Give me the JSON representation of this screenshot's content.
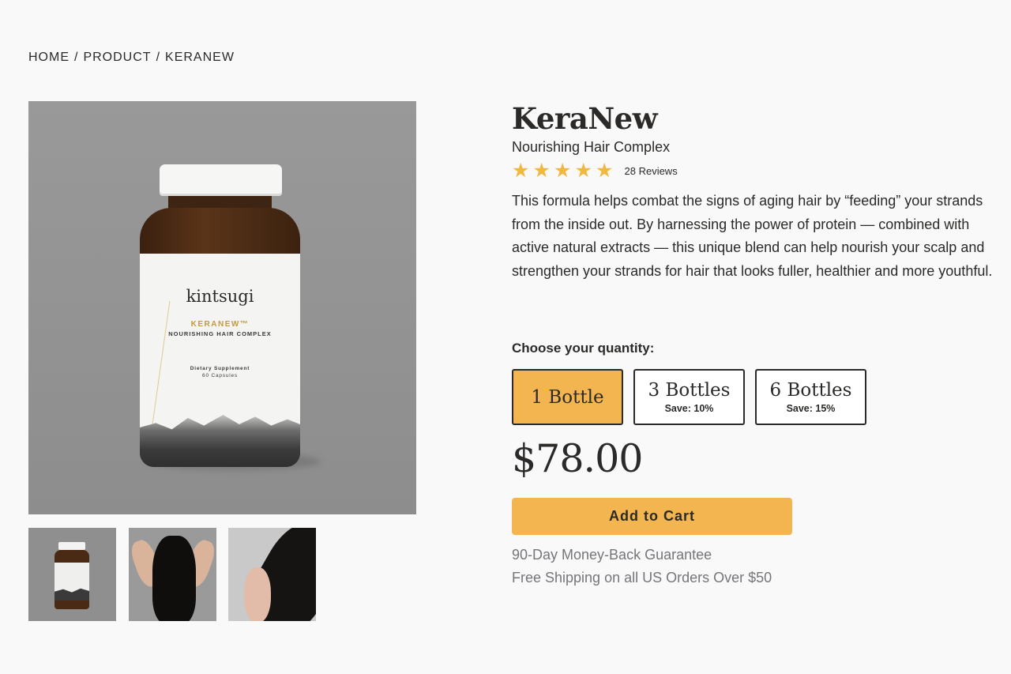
{
  "breadcrumb": {
    "home": "HOME",
    "product": "PRODUCT",
    "current": "KERANEW",
    "separator": "/"
  },
  "product_image": {
    "brand": "kintsugi",
    "name": "KERANEW™",
    "subtitle": "NOURISHING HAIR COMPLEX",
    "supplement": "Dietary Supplement",
    "capsules": "60 Capsules"
  },
  "thumbnails": [
    "bottle",
    "hair-back",
    "hair-hand"
  ],
  "product": {
    "title": "KeraNew",
    "subtitle": "Nourishing Hair Complex",
    "rating": 5,
    "reviews": "28 Reviews",
    "description": "This formula helps combat the signs of aging hair by “feeding” your strands from the inside out. By harnessing the power of protein — combined with active natural extracts — this unique blend can help nourish your scalp and strengthen your strands for hair that looks fuller, healthier and more youthful."
  },
  "quantity": {
    "label": "Choose your quantity:",
    "options": [
      {
        "name": "1 Bottle",
        "save": ""
      },
      {
        "name": "3 Bottles",
        "save": "Save: 10%"
      },
      {
        "name": "6 Bottles",
        "save": "Save: 15%"
      }
    ],
    "selected": 0
  },
  "price": "$78.00",
  "cart_button": "Add to Cart",
  "perks": [
    "90-Day Money-Back Guarantee",
    "Free Shipping on all US Orders Over $50"
  ],
  "colors": {
    "accent": "#f3b54f",
    "star": "#f1b73f",
    "text": "#2b2a28",
    "muted": "#76757a",
    "background": "#f9f9f9"
  }
}
